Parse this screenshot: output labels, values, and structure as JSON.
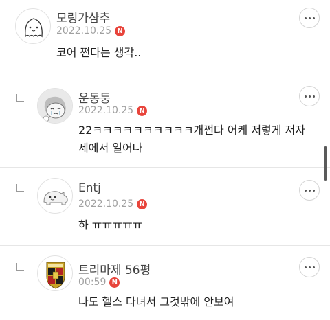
{
  "comments": [
    {
      "name": "모링가샴추",
      "date": "2022.10.25",
      "badge": "N",
      "lines": [
        "코어 쩐다는 생각.."
      ],
      "avatar_icon": "ghost-avatar-icon"
    },
    {
      "name": "운동둥",
      "date": "2022.10.25",
      "badge": "N",
      "lines": [
        "22ㅋㅋㅋㅋㅋㅋㅋㅋㅋㅋ개쩐다 어케 저렇게 저자",
        "세에서 일어나"
      ],
      "avatar_icon": "crying-face-avatar-icon"
    },
    {
      "name": "Entj",
      "date": "2022.10.25",
      "badge": "N",
      "lines": [
        "하 ㅠㅠㅠㅠㅠ"
      ],
      "avatar_icon": "dinosaur-avatar-icon"
    },
    {
      "name": "트리마제 56평",
      "date": "00:59",
      "badge": "N",
      "lines": [
        "나도 헬스 다녀서 그것밖에 안보여"
      ],
      "avatar_icon": "porsche-crest-avatar-icon"
    }
  ]
}
